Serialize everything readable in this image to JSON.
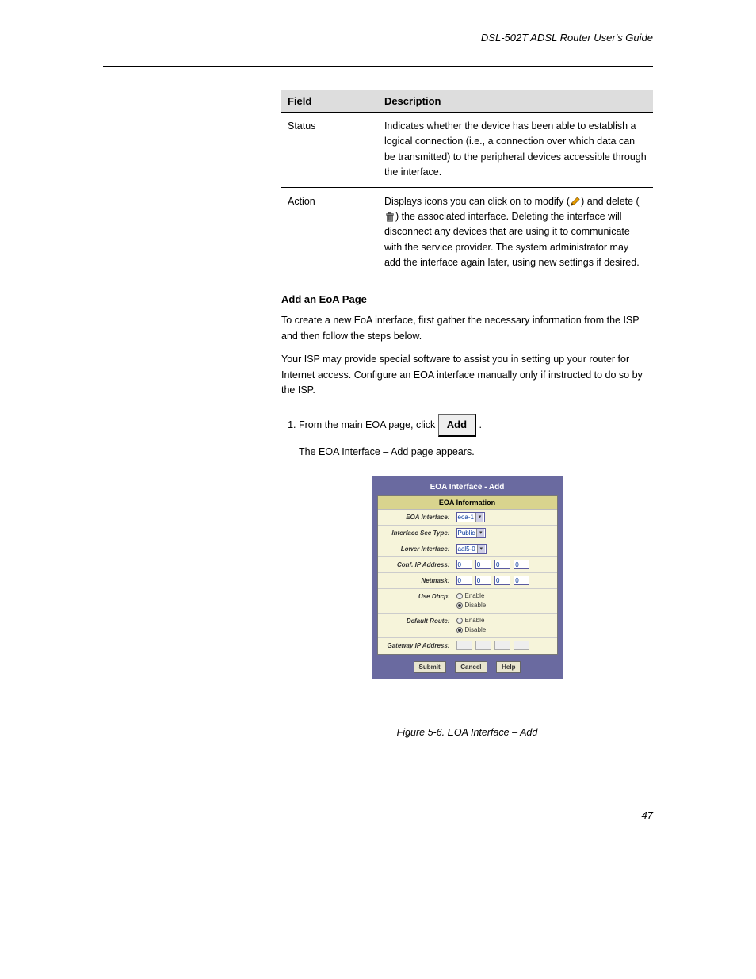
{
  "header": {
    "doc_title": "DSL-502T ADSL Router User's Guide"
  },
  "table": {
    "col_field": "Field",
    "col_desc": "Description",
    "rows": [
      {
        "name": "Status",
        "desc": "Indicates whether the device has been able to establish a logical connection (i.e., a connection over which data can be transmitted) to the peripheral devices accessible through the interface."
      },
      {
        "name": "Action",
        "desc_pre": "Displays icons you can click on to modify (",
        "desc_mid": ") and delete (",
        "desc_end": ") the associated interface. Deleting the interface will disconnect any devices that are using it to communicate with the service provider. The system administrator may add the interface again later, using new settings if desired."
      }
    ]
  },
  "section": {
    "heading": "Add an EoA Page",
    "intro1": "To create a new EoA interface, first gather the necessary information from the ISP and then follow the steps below.",
    "intro2": "Your ISP may provide special software to assist you in setting up your router for Internet access. Configure an EOA interface manually only if instructed to do so by the ISP.",
    "step1_pre": "From the main EOA page, click ",
    "step1_post": ".",
    "step2": "The EOA Interface – Add page appears."
  },
  "figure": {
    "caption": "Figure 5-6. EOA Interface – Add"
  },
  "dialog": {
    "title": "EOA Interface - Add",
    "section_header": "EOA Information",
    "rows": {
      "interface_label": "EOA Interface:",
      "interface_value": "eoa-1",
      "sectype_label": "Interface Sec Type:",
      "sectype_value": "Public",
      "lower_label": "Lower Interface:",
      "lower_value": "aal5-0",
      "confip_label": "Conf. IP Address:",
      "confip": [
        "0",
        "0",
        "0",
        "0"
      ],
      "netmask_label": "Netmask:",
      "netmask": [
        "0",
        "0",
        "0",
        "0"
      ],
      "dhcp_label": "Use Dhcp:",
      "dhcp_enable": "Enable",
      "dhcp_disable": "Disable",
      "defroute_label": "Default Route:",
      "defroute_enable": "Enable",
      "defroute_disable": "Disable",
      "gateway_label": "Gateway IP Address:"
    },
    "buttons": {
      "submit": "Submit",
      "cancel": "Cancel",
      "help": "Help"
    }
  },
  "add_button": "Add",
  "footer": {
    "page": "47"
  }
}
